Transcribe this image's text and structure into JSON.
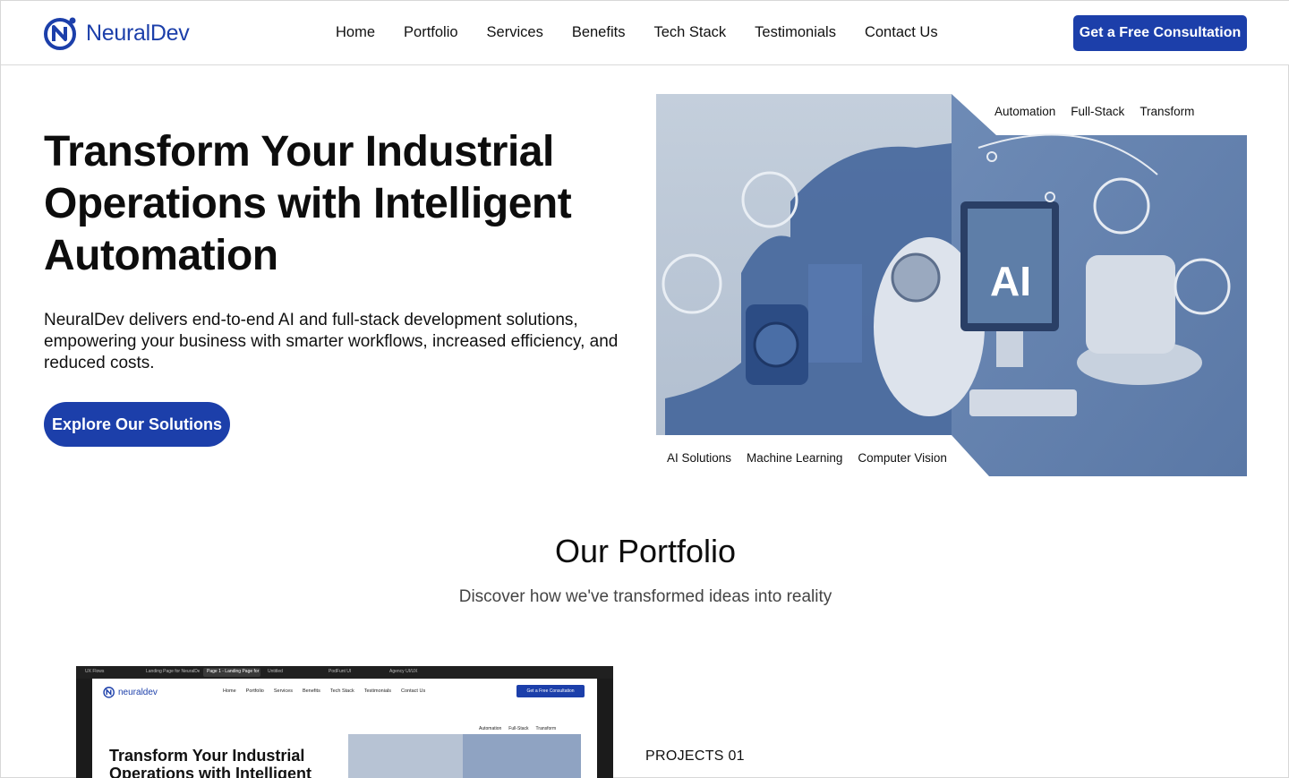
{
  "brand": {
    "name": "NeuralDev",
    "color": "#1c3faa"
  },
  "nav": {
    "links": [
      "Home",
      "Portfolio",
      "Services",
      "Benefits",
      "Tech Stack",
      "Testimonials",
      "Contact Us"
    ],
    "cta": "Get a Free Consultation"
  },
  "hero": {
    "title_lines": [
      "Transform Your Industrial",
      "Operations with Intelligent",
      "Automation"
    ],
    "subtitle": "NeuralDev delivers end-to-end AI and full-stack development solutions, empowering your business with smarter workflows, increased efficiency, and reduced costs.",
    "button": "Explore Our Solutions",
    "tags_top": [
      "Automation",
      "Full-Stack",
      "Transform"
    ],
    "tags_bottom": [
      "AI Solutions",
      "Machine Learning",
      "Computer Vision"
    ],
    "image_text": "AI"
  },
  "portfolio": {
    "title": "Our Portfolio",
    "subtitle": "Discover how we've transformed ideas into reality",
    "project_label": "PROJECTS 01",
    "preview": {
      "tabs": [
        "UX Flows",
        "Landing Page for NeuralDev",
        "Page 1 - Landing Page for NeuralDev",
        "Untitled",
        "PodFunt UI",
        "Agency UI/UX"
      ],
      "logo": "neuraldev",
      "nav": [
        "Home",
        "Portfolio",
        "Services",
        "Benefits",
        "Tech Stack",
        "Testimonials",
        "Contact Us"
      ],
      "cta": "Get a Free Consultation",
      "title_lines": [
        "Transform Your Industrial",
        "Operations with Intelligent"
      ],
      "tags": [
        "Automation",
        "Full-Stack",
        "Transform"
      ]
    }
  }
}
